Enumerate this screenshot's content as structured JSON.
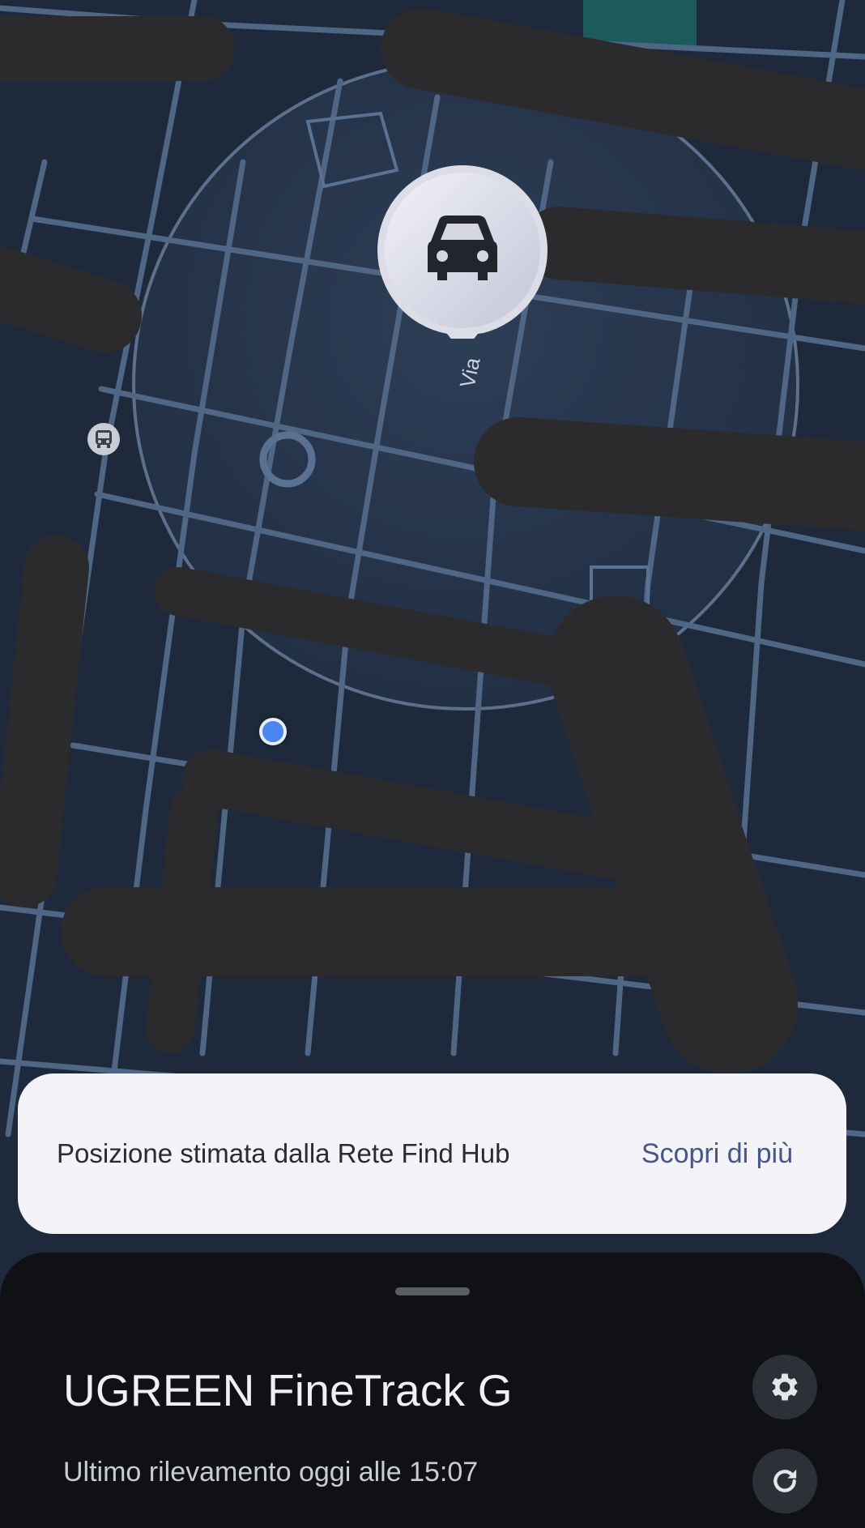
{
  "map": {
    "street_label": "Via",
    "marker_icon": "car-icon",
    "poi_icon": "bus-icon",
    "current_location_color": "#4a86f0",
    "accuracy_circle_color": "#8fa6c8"
  },
  "info_card": {
    "text": "Posizione stimata dalla Rete Find Hub",
    "link_label": "Scopri di più"
  },
  "sheet": {
    "device_name": "UGREEN FineTrack G",
    "last_seen": "Ultimo rilevamento oggi alle 15:07",
    "settings_icon": "gear-icon",
    "refresh_icon": "refresh-icon"
  }
}
